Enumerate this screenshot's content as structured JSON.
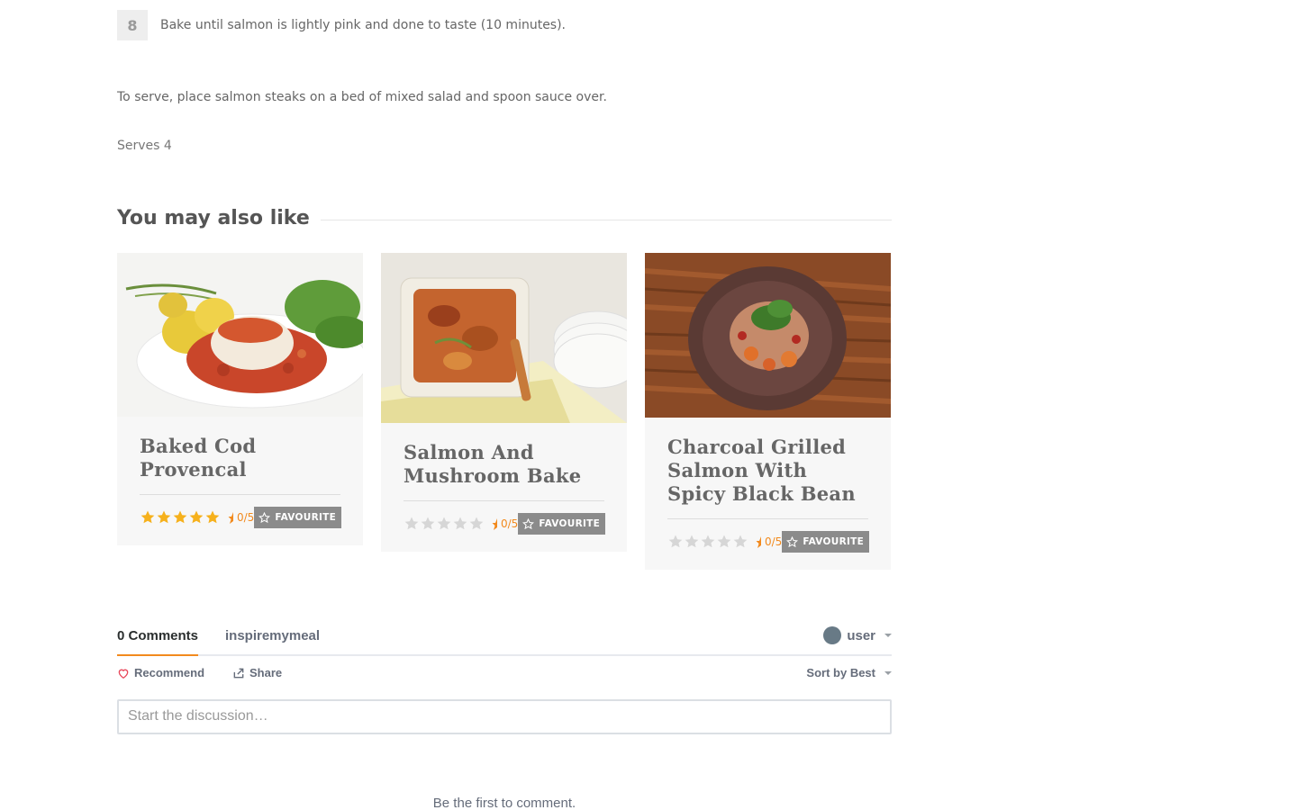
{
  "recipe": {
    "step": {
      "number": "8",
      "text": "Bake until salmon is lightly pink and done to taste (10 minutes)."
    },
    "serve_text": "To serve, place salmon steaks on a bed of mixed salad and spoon sauce over.",
    "serves": "Serves 4"
  },
  "related": {
    "title": "You may also like",
    "cards": [
      {
        "title": "Baked Cod Provencal",
        "rating": "0/5",
        "rating_value": 0,
        "favourite_label": "FAVOURITE",
        "stars_filled": true
      },
      {
        "title": "Salmon And Mushroom Bake",
        "rating": "0/5",
        "rating_value": 0,
        "favourite_label": "FAVOURITE",
        "stars_filled": false
      },
      {
        "title": "Charcoal Grilled Salmon With Spicy Black Bean",
        "rating": "0/5",
        "rating_value": 0,
        "favourite_label": "FAVOURITE",
        "stars_filled": false
      }
    ]
  },
  "comments": {
    "count_tab": "0 Comments",
    "site_tab": "inspiremymeal",
    "user": "user",
    "recommend": "Recommend",
    "share": "Share",
    "sort": "Sort by Best",
    "placeholder": "Start the discussion…",
    "empty": "Be the first to comment."
  },
  "colors": {
    "accent": "#f28a1e",
    "star_filled": "#f6b11c",
    "star_empty": "#d6d6d6",
    "favourite_bg": "#8b8b8b"
  }
}
